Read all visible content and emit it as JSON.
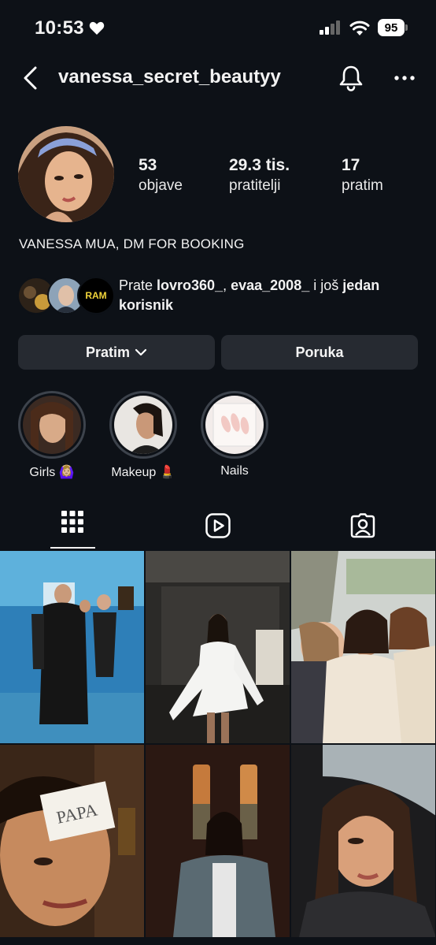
{
  "status": {
    "time": "10:53",
    "battery": "95"
  },
  "header": {
    "username": "vanessa_secret_beautyy"
  },
  "stats": [
    {
      "value": "53",
      "label": "objave"
    },
    {
      "value": "29.3 tis.",
      "label": "pratitelji"
    },
    {
      "value": "17",
      "label": "pratim"
    }
  ],
  "bio": "VANESSA MUA, DM FOR BOOKING",
  "mutual": {
    "prefix": "Prate ",
    "user1": "lovro360_",
    "sep": ", ",
    "user2": "evaa_2008_",
    "mid": " i još ",
    "rest": "jedan korisnik",
    "avatar3_text": "RAM"
  },
  "buttons": {
    "follow": "Pratim",
    "message": "Poruka"
  },
  "highlights": [
    {
      "label": "Girls 🙆🏼‍♀️"
    },
    {
      "label": "Makeup 💄"
    },
    {
      "label": "Nails"
    }
  ],
  "note_text": "PAPA",
  "colors": {
    "background": "#0d1117",
    "button": "#262a31",
    "text": "#f2f2f2"
  }
}
